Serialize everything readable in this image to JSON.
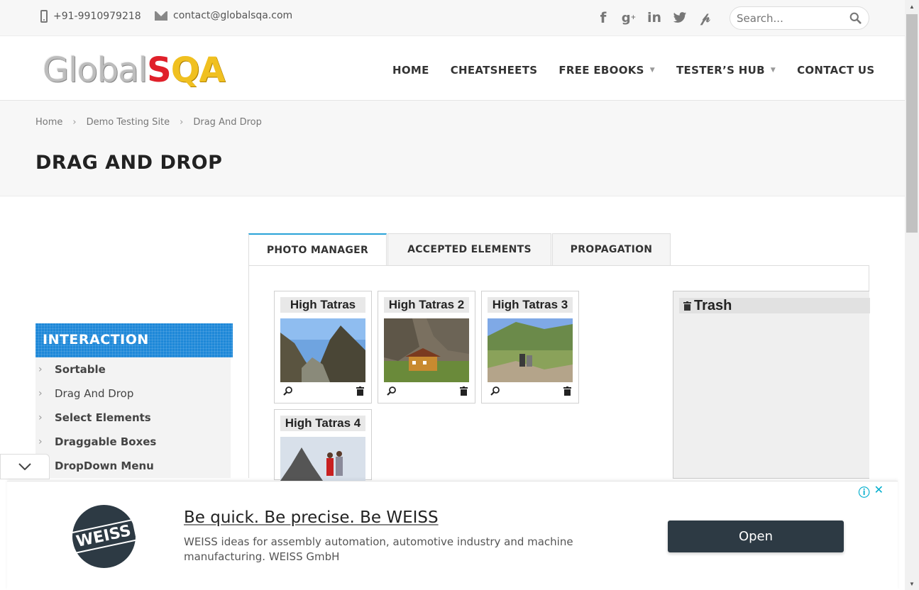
{
  "topbar": {
    "phone": "+91-9910979218",
    "email": "contact@globalsqa.com",
    "social": [
      "facebook-icon",
      "google-plus-icon",
      "linkedin-icon",
      "twitter-icon",
      "pinterest-icon"
    ],
    "search_placeholder": "Search..."
  },
  "header": {
    "logo_part1": "Global",
    "logo_part2": "S",
    "logo_part3": "QA",
    "nav": [
      {
        "label": "HOME"
      },
      {
        "label": "CHEATSHEETS"
      },
      {
        "label": "FREE EBOOKS"
      },
      {
        "label": "TESTER’S HUB"
      },
      {
        "label": "CONTACT US"
      }
    ]
  },
  "breadcrumb": [
    "Home",
    "Demo Testing Site",
    "Drag And Drop"
  ],
  "page_title": "DRAG AND DROP",
  "sidebar": {
    "title": "INTERACTION",
    "items": [
      "Sortable",
      "Drag And Drop",
      "Select Elements",
      "Draggable Boxes",
      "DropDown Menu"
    ]
  },
  "tabs": [
    "PHOTO MANAGER",
    "ACCEPTED ELEMENTS",
    "PROPAGATION"
  ],
  "gallery": [
    {
      "title": "High Tatras"
    },
    {
      "title": "High Tatras 2"
    },
    {
      "title": "High Tatras 3"
    },
    {
      "title": "High Tatras 4"
    }
  ],
  "trash": {
    "title": "Trash"
  },
  "ad": {
    "headline": "Be quick. Be precise. Be WEISS",
    "description": "WEISS ideas for assembly automation, automotive industry and machine manufacturing. WEISS GmbH",
    "logo_text": "WEISS",
    "button": "Open",
    "info_icon": "ⓘ",
    "close_icon": "✕"
  },
  "colors": {
    "accent": "#1e88d8",
    "tab_active": "#29a3d8",
    "ad_button": "#2d3a44"
  }
}
